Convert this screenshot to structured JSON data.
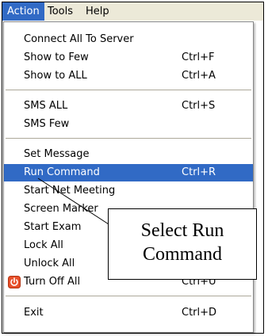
{
  "menubar": {
    "items": [
      {
        "label": "Action"
      },
      {
        "label": "Tools"
      },
      {
        "label": "Help"
      }
    ]
  },
  "menu": {
    "items": [
      {
        "label": "Connect All To Server",
        "shortcut": ""
      },
      {
        "label": "Show to Few",
        "shortcut": "Ctrl+F"
      },
      {
        "label": "Show to ALL",
        "shortcut": "Ctrl+A"
      },
      {
        "label": "SMS ALL",
        "shortcut": "Ctrl+S"
      },
      {
        "label": "SMS Few",
        "shortcut": ""
      },
      {
        "label": "Set Message",
        "shortcut": ""
      },
      {
        "label": "Run Command",
        "shortcut": "Ctrl+R"
      },
      {
        "label": "Start Net Meeting",
        "shortcut": ""
      },
      {
        "label": "Screen Marker",
        "shortcut": ""
      },
      {
        "label": "Start Exam",
        "shortcut": ""
      },
      {
        "label": "Lock All",
        "shortcut": ""
      },
      {
        "label": "Unlock All",
        "shortcut": ""
      },
      {
        "label": "Turn Off All",
        "shortcut": "Ctrl+U",
        "icon": "power-icon"
      },
      {
        "label": "Exit",
        "shortcut": "Ctrl+D"
      }
    ]
  },
  "callout": {
    "line1": "Select Run",
    "line2": "Command"
  },
  "colors": {
    "highlight": "#316ac5",
    "menubar_bg": "#ece9d8",
    "power_icon": "#e8502a"
  }
}
